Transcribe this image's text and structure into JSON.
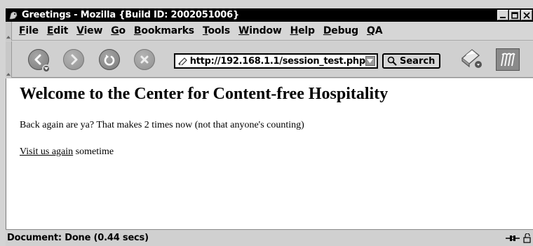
{
  "window": {
    "title": "Greetings - Mozilla {Build ID: 2002051006}"
  },
  "menubar": {
    "items": [
      {
        "key": "F",
        "rest": "ile"
      },
      {
        "key": "E",
        "rest": "dit"
      },
      {
        "key": "V",
        "rest": "iew"
      },
      {
        "key": "G",
        "rest": "o"
      },
      {
        "key": "B",
        "rest": "ookmarks"
      },
      {
        "key": "T",
        "rest": "ools"
      },
      {
        "key": "W",
        "rest": "indow"
      },
      {
        "key": "H",
        "rest": "elp"
      },
      {
        "key": "D",
        "rest": "ebug"
      },
      {
        "key": "Q",
        "rest": "A"
      }
    ]
  },
  "toolbar": {
    "url": "http://192.168.1.1/session_test.php",
    "search_label": "Search"
  },
  "page": {
    "heading": "Welcome to the Center for Content-free Hospitality",
    "paragraph": "Back again are ya? That makes 2 times now (not that anyone's counting)",
    "link_text": "Visit us again",
    "link_suffix": " sometime"
  },
  "status": {
    "text": "Document: Done (0.44 secs)"
  }
}
